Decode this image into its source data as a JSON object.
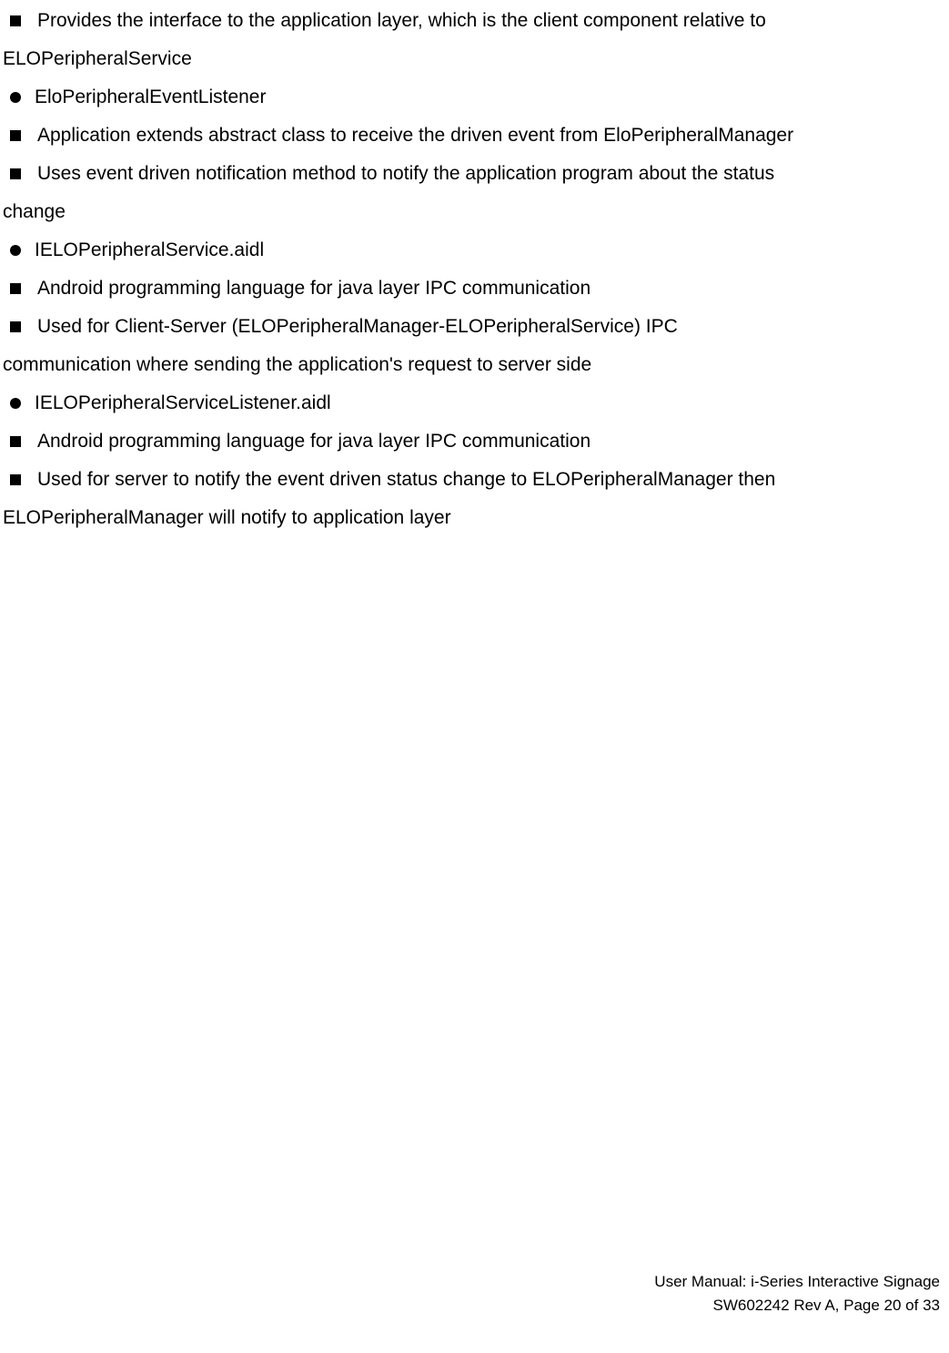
{
  "items": [
    {
      "bullet": "square",
      "text": "Provides the interface to the application layer, which is the client component relative to"
    },
    {
      "bullet": "none",
      "text": "ELOPeripheralService"
    },
    {
      "bullet": "circle",
      "text": "EloPeripheralEventListener"
    },
    {
      "bullet": "square",
      "text": "Application extends abstract class to receive the driven event from EloPeripheralManager"
    },
    {
      "bullet": "square",
      "text": "Uses event driven notification method to notify the application program about the status"
    },
    {
      "bullet": "none",
      "text": "change"
    },
    {
      "bullet": "circle",
      "text": "IELOPeripheralService.aidl"
    },
    {
      "bullet": "square",
      "text": "Android programming language for java layer IPC communication"
    },
    {
      "bullet": "square",
      "text": "Used for Client-Server (ELOPeripheralManager-ELOPeripheralService) IPC"
    },
    {
      "bullet": "none",
      "text": "communication where sending the application's request to server side"
    },
    {
      "bullet": "circle",
      "text": "IELOPeripheralServiceListener.aidl"
    },
    {
      "bullet": "square",
      "text": "Android programming language for java layer IPC communication"
    },
    {
      "bullet": "square",
      "text": "Used for server to notify the event driven status change to ELOPeripheralManager then"
    },
    {
      "bullet": "none",
      "text": "ELOPeripheralManager will notify to application layer"
    }
  ],
  "footer": {
    "line1": "User Manual: i-Series Interactive Signage",
    "line2": "SW602242 Rev A, Page 20 of 33"
  }
}
